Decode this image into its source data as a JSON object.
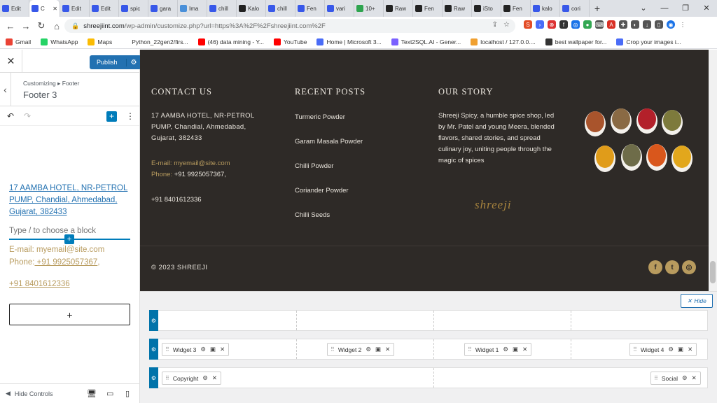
{
  "browser": {
    "tabs": [
      {
        "label": "Edit",
        "active": false,
        "color": "#3858e9"
      },
      {
        "label": "C",
        "active": true,
        "color": "#3858e9"
      },
      {
        "label": "Edit",
        "active": false,
        "color": "#3858e9"
      },
      {
        "label": "Edit",
        "active": false,
        "color": "#3858e9"
      },
      {
        "label": "spic",
        "active": false,
        "color": "#3858e9"
      },
      {
        "label": "gara",
        "active": false,
        "color": "#3858e9"
      },
      {
        "label": "Ima",
        "active": false,
        "color": "#4a90d9"
      },
      {
        "label": "chill",
        "active": false,
        "color": "#3858e9"
      },
      {
        "label": "Kalo",
        "active": false,
        "color": "#222222"
      },
      {
        "label": "chill",
        "active": false,
        "color": "#3858e9"
      },
      {
        "label": "Fen",
        "active": false,
        "color": "#3858e9"
      },
      {
        "label": "vari",
        "active": false,
        "color": "#3858e9"
      },
      {
        "label": "10+",
        "active": false,
        "color": "#2ea44f"
      },
      {
        "label": "Raw",
        "active": false,
        "color": "#222222"
      },
      {
        "label": "Fen",
        "active": false,
        "color": "#222222"
      },
      {
        "label": "Raw",
        "active": false,
        "color": "#222222"
      },
      {
        "label": "iSto",
        "active": false,
        "color": "#222222"
      },
      {
        "label": "Fen",
        "active": false,
        "color": "#222222"
      },
      {
        "label": "kalo",
        "active": false,
        "color": "#3858e9"
      },
      {
        "label": "cori",
        "active": false,
        "color": "#3858e9"
      }
    ],
    "new_tab": "+",
    "url_domain": "shreejiint.com",
    "url_rest": "/wp-admin/customize.php?url=https%3A%2F%2Fshreejiint.com%2F",
    "bookmarks": [
      {
        "label": "Gmail",
        "icon": "gmail-icon",
        "color": "#ea4335"
      },
      {
        "label": "WhatsApp",
        "icon": "whatsapp-icon",
        "color": "#25d366"
      },
      {
        "label": "Maps",
        "icon": "maps-icon",
        "color": "#fbbc04"
      },
      {
        "label": "Python_22gen2/firs...",
        "icon": "folder-icon",
        "color": "#ffffff"
      },
      {
        "label": "(46) data mining - Y...",
        "icon": "youtube-icon",
        "color": "#ff0000"
      },
      {
        "label": "YouTube",
        "icon": "youtube-icon",
        "color": "#ff0000"
      },
      {
        "label": "Home | Microsoft 3...",
        "icon": "microsoft-icon",
        "color": "#4a6cf7"
      },
      {
        "label": "Text2SQL.AI - Gener...",
        "icon": "sql-icon",
        "color": "#7b61ff"
      },
      {
        "label": "localhost / 127.0.0....",
        "icon": "phpmyadmin-icon",
        "color": "#f0a030"
      },
      {
        "label": "best wallpaper for...",
        "icon": "globe-icon",
        "color": "#333333"
      },
      {
        "label": "Crop your images i...",
        "icon": "crop-icon",
        "color": "#4a6cf7"
      }
    ]
  },
  "customizer": {
    "publish_label": "Publish",
    "breadcrumb": "Customizing ▸ Footer",
    "section_title": "Footer 3",
    "address_link": "17 AAMBA HOTEL, NR-PETROL PUMP, Chandial, Ahmedabad, Gujarat, 382433",
    "block_placeholder": "Type / to choose a block",
    "email_line": "E-mail: myemail@site.com",
    "phone_label": "Phone:",
    "phone_1": " +91 9925057367",
    "phone_1_suffix": ",",
    "phone_2": "+91 8401612336 ",
    "add_block": "+",
    "hide_controls": "Hide Controls"
  },
  "footer": {
    "contact_title": "CONTACT US",
    "contact_address": "17 AAMBA HOTEL, NR-PETROL PUMP, Chandial, Ahmedabad, Gujarat, 382433",
    "email": "E-mail: myemail@site.com",
    "phone_label": "Phone: ",
    "phone_1": "+91 9925057367,",
    "phone_2": "+91 8401612336",
    "posts_title": "RECENT POSTS",
    "posts": [
      "Turmeric Powder",
      "Garam Masala Powder",
      "Chilli Powder",
      "Coriander Powder",
      "Chilli Seeds"
    ],
    "story_title": "OUR STORY",
    "story_text": "Shreeji Spicy, a humble spice shop, led by Mr. Patel and young Meera, blended flavors, shared stories, and spread culinary joy, uniting people through the magic of spices",
    "logo_text": "shreeji",
    "copyright": "© 2023 SHREEJI",
    "social_icons": [
      "facebook-icon",
      "twitter-icon",
      "instagram-icon"
    ],
    "accent_color": "#b89b5e",
    "background_color": "#2e2a27"
  },
  "builder": {
    "hide_label": "Hide",
    "rows": [
      {
        "widgets": []
      },
      {
        "widgets": [
          "Widget 3",
          "Widget 2",
          "Widget 1",
          "Widget 4"
        ]
      },
      {
        "widgets": [
          "Copyright",
          "Social"
        ]
      }
    ]
  }
}
